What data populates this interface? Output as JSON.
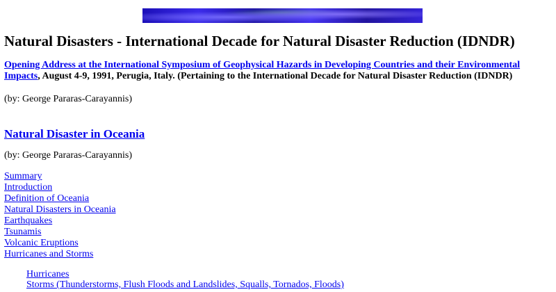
{
  "header": {
    "banner_image": "banner-graphic",
    "title": "Natural Disasters - International Decade for Natural Disaster Reduction (IDNDR)"
  },
  "intro": {
    "link_text": "Opening Address at the International Symposium of Geophysical Hazards in Developing Countries and their Environmental Impacts",
    "rest_text": ", August 4-9, 1991, Perugia, Italy. (Pertaining to the International Decade for Natural Disaster Reduction (IDNDR)"
  },
  "byline_1": "(by: George Pararas-Carayannis)",
  "section": {
    "heading_link": "Natural Disaster in Oceania",
    "byline": "(by: George Pararas-Carayannis)"
  },
  "toc": {
    "items": [
      "Summary",
      "Introduction",
      "Definition of Oceania",
      "Natural Disasters in Oceania",
      "Earthquakes",
      "Tsunamis",
      "Volcanic Eruptions",
      "Hurricanes and Storms"
    ],
    "subitems": [
      "Hurricanes",
      "Storms (Thunderstorms, Flush Floods and Landslides, Squalls, Tornados, Floods)"
    ]
  },
  "colors": {
    "link": "#0000ee",
    "text": "#000000",
    "background": "#ffffff",
    "banner": "#3b2bea"
  }
}
